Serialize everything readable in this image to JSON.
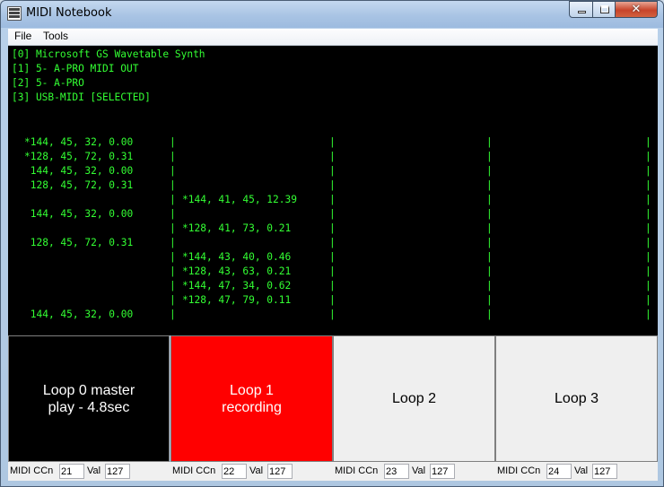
{
  "window": {
    "title": "MIDI Notebook"
  },
  "menu": {
    "file": "File",
    "tools": "Tools"
  },
  "devices": [
    "[0] Microsoft GS Wavetable Synth",
    "[1] 5- A-PRO MIDI OUT",
    "[2] 5- A-PRO",
    "[3] USB-MIDI [SELECTED]"
  ],
  "events": {
    "col0": [
      "*144, 45, 32, 0.00",
      "*128, 45, 72, 0.31",
      " 144, 45, 32, 0.00",
      " 128, 45, 72, 0.31",
      "",
      " 144, 45, 32, 0.00",
      "",
      " 128, 45, 72, 0.31",
      "",
      "",
      "",
      "",
      " 144, 45, 32, 0.00"
    ],
    "col1": [
      "",
      "",
      "",
      "",
      "*144, 41, 45, 12.39",
      "",
      "*128, 41, 73, 0.21",
      "",
      "*144, 43, 40, 0.46",
      "*128, 43, 63, 0.21",
      "*144, 47, 34, 0.62",
      "*128, 47, 79, 0.11",
      ""
    ]
  },
  "loops": [
    {
      "line1": "Loop 0 master",
      "line2": "play - 4.8sec",
      "color": "#000000",
      "text_color": "#ffffff"
    },
    {
      "line1": "Loop 1",
      "line2": "recording",
      "color": "#ff0000",
      "text_color": "#ffffff"
    },
    {
      "line1": "Loop 2",
      "line2": "",
      "color": "#efefef",
      "text_color": "#000000"
    },
    {
      "line1": "Loop 3",
      "line2": "",
      "color": "#efefef",
      "text_color": "#000000"
    }
  ],
  "cc_controls": [
    {
      "cc_label": "MIDI CCn",
      "cc_value": "21",
      "val_label": "Val",
      "val_value": "127"
    },
    {
      "cc_label": "MIDI CCn",
      "cc_value": "22",
      "val_label": "Val",
      "val_value": "127"
    },
    {
      "cc_label": "MIDI CCn",
      "cc_value": "23",
      "val_label": "Val",
      "val_value": "127"
    },
    {
      "cc_label": "MIDI CCn",
      "cc_value": "24",
      "val_label": "Val",
      "val_value": "127"
    }
  ],
  "colors": {
    "console_text": "#33ff33",
    "console_bg": "#000000",
    "recording": "#ff0000"
  }
}
